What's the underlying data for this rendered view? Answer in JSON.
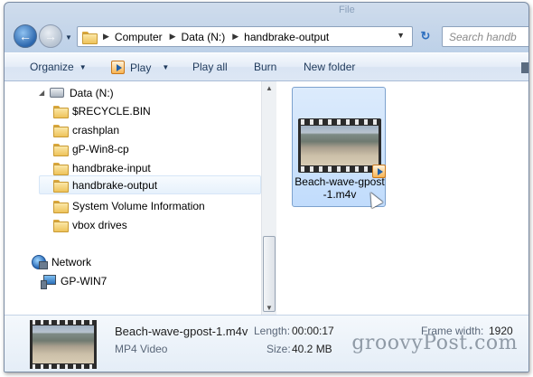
{
  "titlebar": {
    "hint": "File"
  },
  "address": {
    "crumbs": [
      "Computer",
      "Data (N:)",
      "handbrake-output"
    ]
  },
  "search": {
    "placeholder": "Search handb"
  },
  "toolbar": {
    "organize": "Organize",
    "play": "Play",
    "play_all": "Play all",
    "burn": "Burn",
    "new_folder": "New folder"
  },
  "nav": {
    "drive": "Data (N:)",
    "folders": [
      "$RECYCLE.BIN",
      "crashplan",
      "gP-Win8-cp",
      "handbrake-input",
      "handbrake-output",
      "System Volume Information",
      "vbox drives"
    ],
    "selected_folder": "handbrake-output",
    "network": "Network",
    "computer": "GP-WIN7"
  },
  "file": {
    "name": "Beach-wave-gpost-1.m4v",
    "tile_label": "Beach-wave-gpost-1.m4v"
  },
  "details": {
    "name": "Beach-wave-gpost-1.m4v",
    "type": "MP4 Video",
    "length_label": "Length:",
    "length": "00:00:17",
    "size_label": "Size:",
    "size": "40.2 MB",
    "frame_width_label": "Frame width:",
    "frame_width": "1920"
  },
  "watermark": "groovyPost.com",
  "icons": {
    "back": "back-arrow-icon",
    "forward": "forward-arrow-icon",
    "refresh": "refresh-icon",
    "play": "play-icon",
    "folder": "folder-icon",
    "drive": "drive-icon",
    "network": "network-icon",
    "computer": "computer-icon",
    "video": "video-thumbnail-icon"
  },
  "colors": {
    "selection": "#c1dcfc",
    "toolbar_text": "#1e395b"
  }
}
